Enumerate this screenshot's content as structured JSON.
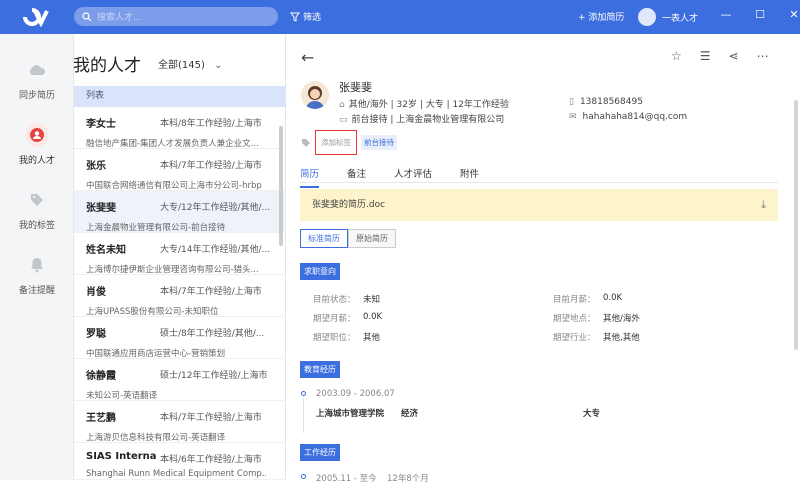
{
  "topbar": {
    "search_placeholder": "搜索人才...",
    "filter_label": "筛选",
    "add_resume_label": "+ 添加简历",
    "user_name": "一表人才",
    "accent": "#3d6ee0"
  },
  "sidenav": {
    "items": [
      {
        "label": "同步简历",
        "icon": "cloud-icon"
      },
      {
        "label": "我的人才",
        "icon": "person-icon"
      },
      {
        "label": "我的标签",
        "icon": "tag-icon"
      },
      {
        "label": "备注提醒",
        "icon": "bell-icon"
      }
    ]
  },
  "list": {
    "title": "我的人才",
    "filter": "全部(145)",
    "header": "列表",
    "rows": [
      {
        "name": "李女士",
        "info": "本科/8年工作经验/上海市",
        "company": "融信地产集团-集团人才发展负责人兼企业文..."
      },
      {
        "name": "张乐",
        "info": "本科/7年工作经验/上海市",
        "company": "中国联合网络通信有限公司上海市分公司-hrbp"
      },
      {
        "name": "张斐斐",
        "info": "大专/12年工作经验/其他/...",
        "company": "上海金晨物业管理有限公司-前台接待"
      },
      {
        "name": "姓名未知",
        "info": "大专/14年工作经验/其他/...",
        "company": "上海博尔捷伊斯企业管理咨询有限公司-猎头..."
      },
      {
        "name": "肖俊",
        "info": "本科/7年工作经验/上海市",
        "company": "上海UPASS股份有限公司-未知职位"
      },
      {
        "name": "罗聪",
        "info": "硕士/8年工作经验/其他/...",
        "company": "中国联通应用商店运营中心-营销策划"
      },
      {
        "name": "徐静霞",
        "info": "硕士/12年工作经验/上海市",
        "company": "未知公司-英语翻译"
      },
      {
        "name": "王艺鹏",
        "info": "本科/7年工作经验/上海市",
        "company": "上海游贝信息科技有限公司-英语翻译"
      },
      {
        "name": "SIAS Interna...",
        "info": "本科/6年工作经验/上海市",
        "company": "Shanghai Runn Medical Equipment Comp..."
      }
    ]
  },
  "detail": {
    "name": "张斐斐",
    "info1": "其他/海外 | 32岁 | 大专 | 12年工作经验",
    "info2": "前台接待 | 上海金晨物业管理有限公司",
    "phone": "13818568495",
    "email": "hahahaha814@qq.com",
    "add_tag": "添加标签",
    "tag": "前台接待",
    "tabs": [
      "简历",
      "备注",
      "人才评估",
      "附件"
    ],
    "file_name": "张斐斐的简历.doc",
    "btn_standard": "标准简历",
    "btn_original": "原始简历",
    "sec_intent": "求职意向",
    "intent": {
      "cur_status_label": "目前状态：",
      "cur_status": "未知",
      "cur_salary_label": "目前月薪：",
      "cur_salary": "0.0K",
      "exp_salary_label": "期望月薪：",
      "exp_salary": "0.0K",
      "exp_location_label": "期望地点：",
      "exp_location": "其他/海外",
      "exp_position_label": "期望职位：",
      "exp_position": "其他",
      "exp_industry_label": "期望行业：",
      "exp_industry": "其他,其他"
    },
    "sec_edu": "教育经历",
    "edu": {
      "period": "2003.09 - 2006.07",
      "school": "上海城市管理学院",
      "major": "经济",
      "degree": "大专"
    },
    "sec_work": "工作经历",
    "work": {
      "period": "2005.11 - 至今",
      "duration": "12年8个月"
    }
  }
}
